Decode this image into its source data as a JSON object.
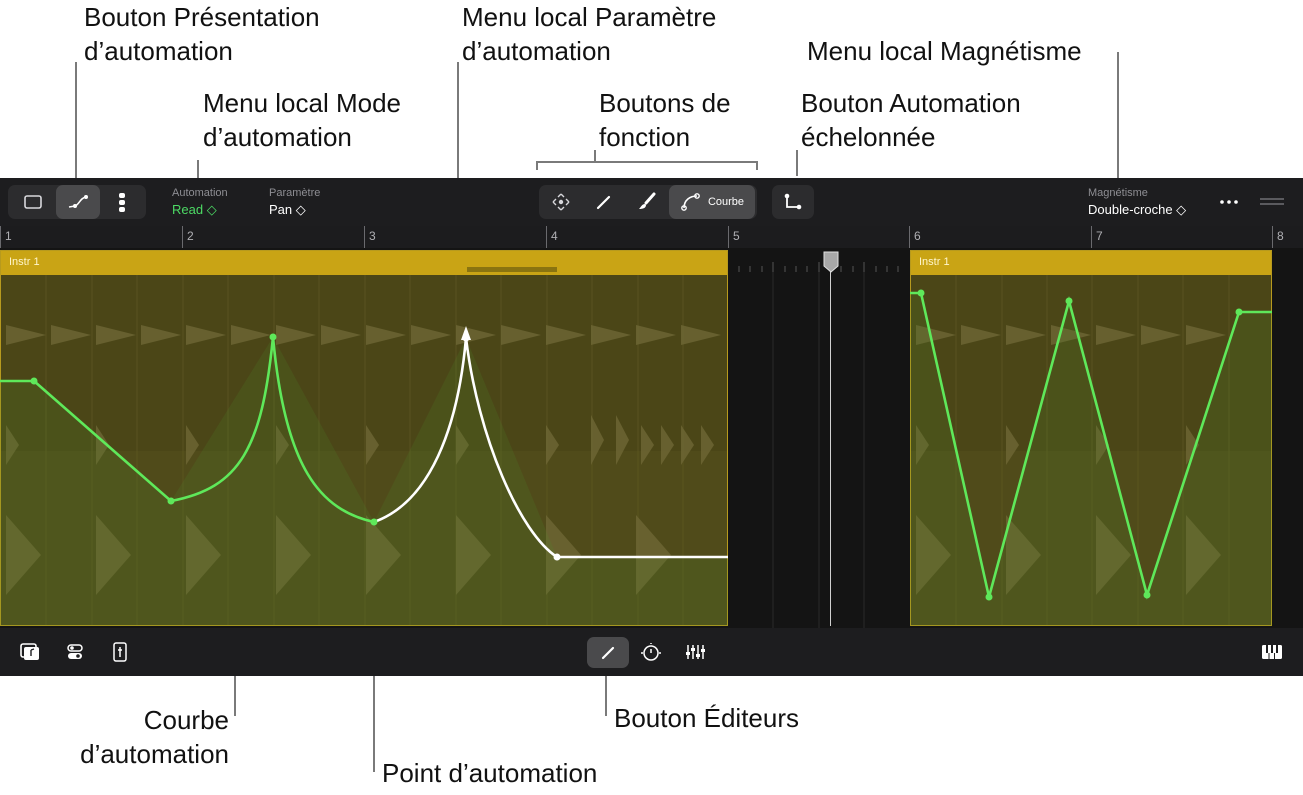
{
  "callouts": {
    "presentation_button": [
      "Bouton Présentation",
      "d’automation"
    ],
    "parameter_menu": [
      "Menu local Paramètre",
      "d’automation"
    ],
    "snap_menu": "Menu local Magnétisme",
    "mode_menu": [
      "Menu local Mode",
      "d’automation"
    ],
    "function_buttons": [
      "Boutons de",
      "fonction"
    ],
    "stepped_button": [
      "Bouton Automation",
      "échelonnée"
    ],
    "curve": [
      "Courbe",
      "d’automation"
    ],
    "editors_button": "Bouton Éditeurs",
    "point": "Point d’automation"
  },
  "toolbar": {
    "automation_label": "Automation",
    "automation_value": "Read ◇",
    "parameter_label": "Paramètre",
    "parameter_value": "Pan ◇",
    "curve_button_label": "Courbe",
    "snap_label": "Magnétisme",
    "snap_value": "Double-croche ◇",
    "more_icon": "ellipsis-icon",
    "view_icons": [
      "single-window-icon",
      "automation-curve-icon",
      "track-list-icon"
    ],
    "function_icons": [
      "select-move-icon",
      "pencil-icon",
      "brush-icon",
      "curve-icon"
    ],
    "stepped_icon": "stepped-automation-icon"
  },
  "ruler": {
    "bars": [
      "1",
      "2",
      "3",
      "4",
      "5",
      "6",
      "7",
      "8"
    ]
  },
  "regions": [
    {
      "name": "Instr 1"
    },
    {
      "name": "Instr 1"
    }
  ],
  "bottombar": {
    "left_icons": [
      "browser-icon",
      "smart-controls-toggle-icon",
      "inspector-icon"
    ],
    "center_icons": [
      "editors-pencil-icon",
      "metronome-icon",
      "mixer-icon"
    ],
    "right_icon": "keyboard-icon"
  },
  "colors": {
    "automation_line": "#5fe85a",
    "selected_automation_line": "#ffffff",
    "region_header": "#c9a415",
    "region_body": "#4b4617",
    "automation_value_green": "#4cd964"
  }
}
